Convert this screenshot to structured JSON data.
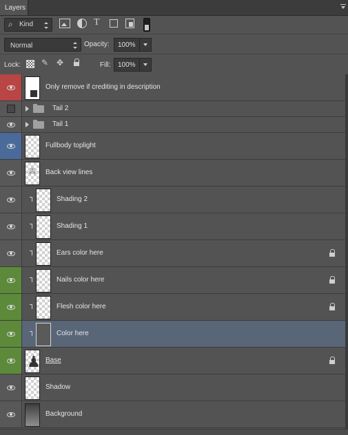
{
  "panel": {
    "tab_label": "Layers",
    "menu_icon": "panel-menu-icon"
  },
  "filter": {
    "kind_label": "Kind",
    "kind_icon": "search-icon",
    "icons": [
      "pixel-filter-icon",
      "adjustment-filter-icon",
      "type-filter-icon",
      "shape-filter-icon",
      "smart-object-filter-icon"
    ],
    "toggle_icon": "filter-toggle-icon"
  },
  "blend": {
    "mode": "Normal",
    "opacity_label": "Opacity:",
    "opacity_value": "100%"
  },
  "lock": {
    "label": "Lock:",
    "icons": [
      "lock-transparent-icon",
      "lock-image-icon",
      "lock-position-icon",
      "lock-all-icon"
    ],
    "fill_label": "Fill:",
    "fill_value": "100%"
  },
  "layers": [
    {
      "name": "Only remove if crediting in description",
      "color": "#b94545",
      "visible": true,
      "thumb": "smart-object",
      "clipped": false,
      "locked": false,
      "type": "layer"
    },
    {
      "name": "Tail 2",
      "color": "",
      "visible": false,
      "type": "group"
    },
    {
      "name": "Tail 1",
      "color": "",
      "visible": true,
      "type": "group"
    },
    {
      "name": "Fullbody toplight",
      "color": "#4a6a9a",
      "visible": true,
      "thumb": "transparent",
      "clipped": false,
      "locked": false,
      "type": "layer"
    },
    {
      "name": "Back view lines",
      "color": "",
      "visible": true,
      "thumb": "sketch",
      "clipped": false,
      "locked": false,
      "type": "layer"
    },
    {
      "name": "Shading 2",
      "color": "",
      "visible": true,
      "thumb": "transparent",
      "clipped": true,
      "locked": false,
      "type": "layer"
    },
    {
      "name": "Shading 1",
      "color": "",
      "visible": true,
      "thumb": "transparent",
      "clipped": true,
      "locked": false,
      "type": "layer"
    },
    {
      "name": "Ears color here",
      "color": "",
      "visible": true,
      "thumb": "transparent",
      "clipped": true,
      "locked": true,
      "type": "layer"
    },
    {
      "name": "Nails color here",
      "color": "#5d8a3a",
      "visible": true,
      "thumb": "transparent",
      "clipped": true,
      "locked": true,
      "type": "layer"
    },
    {
      "name": "Flesh color here",
      "color": "#5d8a3a",
      "visible": true,
      "thumb": "transparent",
      "clipped": true,
      "locked": true,
      "type": "layer"
    },
    {
      "name": "Color here",
      "color": "#5d8a3a",
      "visible": true,
      "thumb": "gray",
      "clipped": true,
      "locked": false,
      "type": "layer",
      "selected": true
    },
    {
      "name": "Base",
      "color": "#5d8a3a",
      "visible": true,
      "thumb": "figure",
      "clipped": false,
      "locked": true,
      "type": "layer"
    },
    {
      "name": "Shadow",
      "color": "",
      "visible": true,
      "thumb": "transparent",
      "clipped": false,
      "locked": false,
      "type": "layer"
    },
    {
      "name": "Background",
      "color": "",
      "visible": true,
      "thumb": "gradient",
      "clipped": false,
      "locked": false,
      "type": "layer"
    }
  ]
}
